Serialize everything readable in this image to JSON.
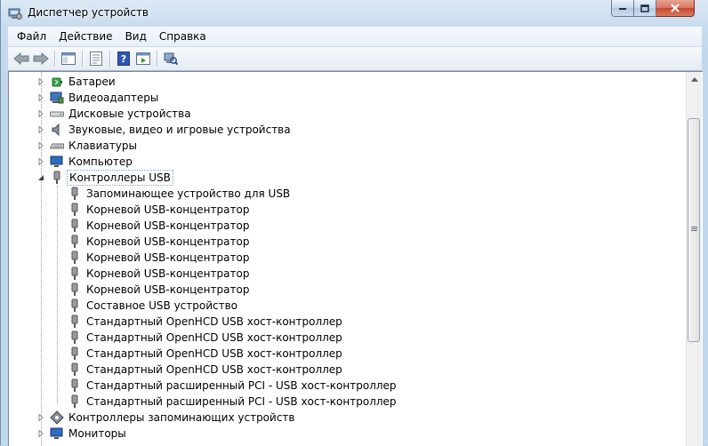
{
  "window": {
    "title": "Диспетчер устройств"
  },
  "menu": [
    "Файл",
    "Действие",
    "Вид",
    "Справка"
  ],
  "toolbar": {
    "buttons": [
      "back-arrow-icon",
      "forward-arrow-icon",
      "console-tree-icon",
      "properties-icon",
      "help-icon",
      "console-view-icon",
      "scan-hardware-icon"
    ]
  },
  "tree": {
    "top_items": [
      {
        "label": "Батареи",
        "icon": "battery-icon"
      },
      {
        "label": "Видеоадаптеры",
        "icon": "display-adapter-icon"
      },
      {
        "label": "Дисковые устройства",
        "icon": "disk-drive-icon"
      },
      {
        "label": "Звуковые, видео и игровые устройства",
        "icon": "speaker-icon"
      },
      {
        "label": "Клавиатуры",
        "icon": "keyboard-icon"
      },
      {
        "label": "Компьютер",
        "icon": "computer-icon"
      }
    ],
    "usb_controllers": {
      "label": "Контроллеры USB",
      "children": [
        "Запоминающее устройство для USB",
        "Корневой USB-концентратор",
        "Корневой USB-концентратор",
        "Корневой USB-концентратор",
        "Корневой USB-концентратор",
        "Корневой USB-концентратор",
        "Корневой USB-концентратор",
        "Составное USB устройство",
        "Стандартный OpenHCD USB хост-контроллер",
        "Стандартный OpenHCD USB хост-контроллер",
        "Стандартный OpenHCD USB хост-контроллер",
        "Стандартный OpenHCD USB хост-контроллер",
        "Стандартный расширенный PCI - USB хост-контроллер",
        "Стандартный расширенный PCI - USB хост-контроллер"
      ]
    },
    "bottom_items": [
      {
        "label": "Контроллеры запоминающих устройств",
        "icon": "storage-controller-icon"
      },
      {
        "label": "Мониторы",
        "icon": "monitor-icon"
      }
    ]
  }
}
